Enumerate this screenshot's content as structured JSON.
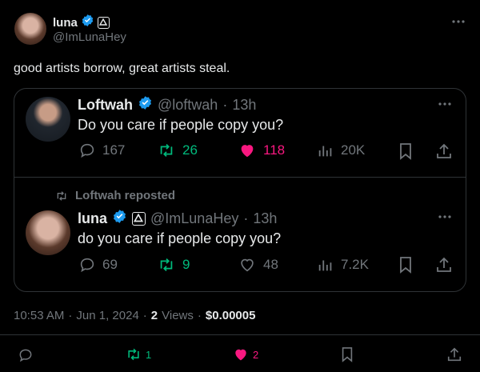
{
  "author": {
    "name": "luna",
    "handle": "@ImLunaHey"
  },
  "tweet_text": "good artists borrow, great artists steal.",
  "quoted_tweet": {
    "name": "Loftwah",
    "handle": "@loftwah",
    "time": "13h",
    "text": "Do you care if people copy you?",
    "replies": "167",
    "reposts": "26",
    "likes": "118",
    "views": "20K"
  },
  "repost_label": "Loftwah reposted",
  "reposted_tweet": {
    "name": "luna",
    "handle": "@ImLunaHey",
    "time": "13h",
    "text": "do you care if people copy you?",
    "replies": "69",
    "reposts": "9",
    "likes": "48",
    "views": "7.2K"
  },
  "meta": {
    "time": "10:53 AM",
    "date": "Jun 1, 2024",
    "views_count": "2",
    "views_label": "Views",
    "earnings": "$0.00005"
  },
  "actions": {
    "reposts": "1",
    "likes": "2"
  },
  "colors": {
    "accent": "#1d9bf0",
    "repost_green": "#00ba7c",
    "like_pink": "#f91880",
    "muted": "#71767b",
    "border": "#2f3336"
  }
}
